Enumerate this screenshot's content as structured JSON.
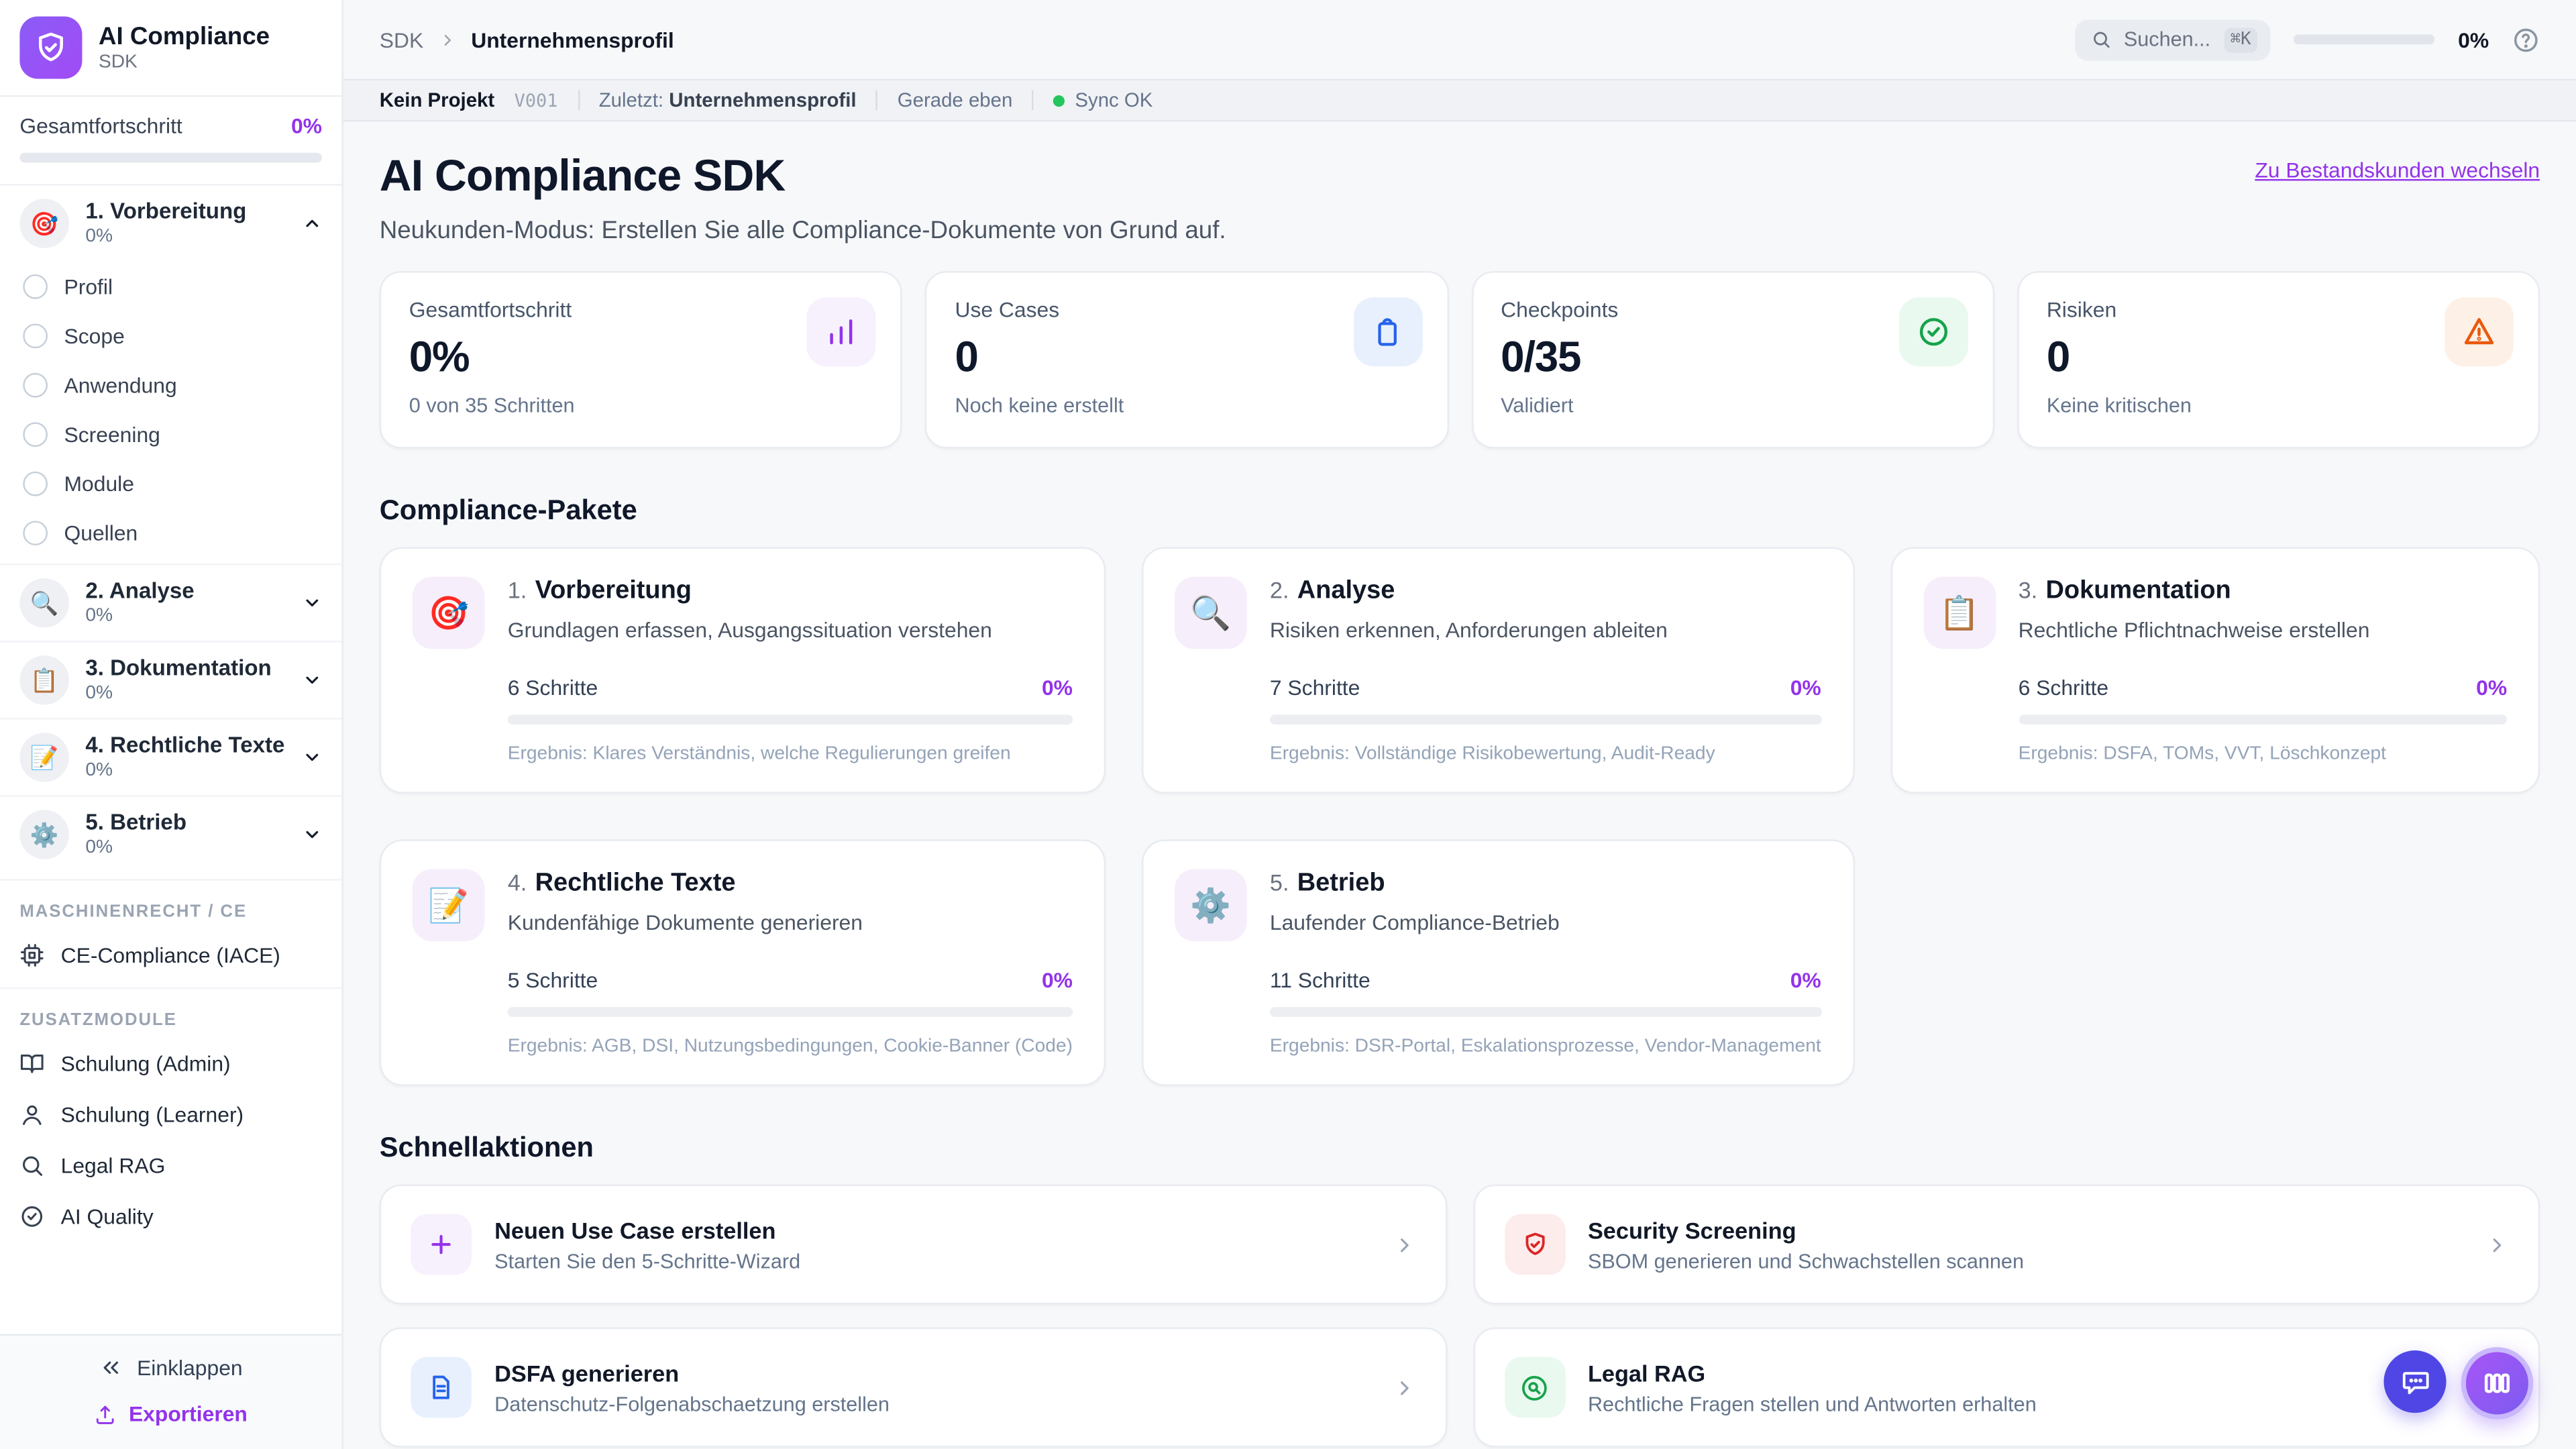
{
  "accent_color": "#9333ea",
  "sync_color": "#22c55e",
  "sidebar": {
    "logo_title": "AI Compliance",
    "logo_subtitle": "SDK",
    "overall_label": "Gesamtfortschritt",
    "overall_percent": "0%",
    "groups": [
      {
        "label": "1. Vorbereitung",
        "percent": "0%",
        "icon": "🎯"
      },
      {
        "label": "2. Analyse",
        "percent": "0%",
        "icon": "🔍"
      },
      {
        "label": "3. Dokumentation",
        "percent": "0%",
        "icon": "📋"
      },
      {
        "label": "4. Rechtliche Texte",
        "percent": "0%",
        "icon": "📝"
      },
      {
        "label": "5. Betrieb",
        "percent": "0%",
        "icon": "⚙️"
      }
    ],
    "sub_items": [
      "Profil",
      "Scope",
      "Anwendung",
      "Screening",
      "Module",
      "Quellen"
    ],
    "section_machine": "MASCHINENRECHT / CE",
    "ce_item": "CE-Compliance (IACE)",
    "section_addons": "ZUSATZMODULE",
    "addons": [
      "Schulung (Admin)",
      "Schulung (Learner)",
      "Legal RAG",
      "AI Quality"
    ],
    "collapse_label": "Einklappen",
    "export_label": "Exportieren"
  },
  "header": {
    "breadcrumb_root": "SDK",
    "breadcrumb_current": "Unternehmensprofil",
    "search_placeholder": "Suchen...",
    "search_shortcut": "⌘K",
    "progress_percent": "0%"
  },
  "statusbar": {
    "project": "Kein Projekt",
    "version": "V001",
    "last_label": "Zuletzt:",
    "last_value": "Unternehmensprofil",
    "time_ago": "Gerade eben",
    "sync_status": "Sync OK"
  },
  "hero": {
    "title": "AI Compliance SDK",
    "subtitle": "Neukunden-Modus: Erstellen Sie alle Compliance-Dokumente von Grund auf.",
    "switch_link": "Zu Bestandskunden wechseln"
  },
  "stats": [
    {
      "label": "Gesamtfortschritt",
      "value": "0%",
      "sub": "0 von 35 Schritten",
      "icon": "bar-chart-icon"
    },
    {
      "label": "Use Cases",
      "value": "0",
      "sub": "Noch keine erstellt",
      "icon": "clipboard-icon"
    },
    {
      "label": "Checkpoints",
      "value": "0/35",
      "sub": "Validiert",
      "icon": "check-circle-icon"
    },
    {
      "label": "Risiken",
      "value": "0",
      "sub": "Keine kritischen",
      "icon": "alert-triangle-icon"
    }
  ],
  "packages": {
    "heading": "Compliance-Pakete",
    "cards": [
      {
        "num": "1.",
        "title": "Vorbereitung",
        "icon": "🎯",
        "desc": "Grundlagen erfassen, Ausgangssituation verstehen",
        "steps": "6 Schritte",
        "percent": "0%",
        "result": "Ergebnis: Klares Verständnis, welche Regulierungen greifen"
      },
      {
        "num": "2.",
        "title": "Analyse",
        "icon": "🔍",
        "desc": "Risiken erkennen, Anforderungen ableiten",
        "steps": "7 Schritte",
        "percent": "0%",
        "result": "Ergebnis: Vollständige Risikobewertung, Audit-Ready"
      },
      {
        "num": "3.",
        "title": "Dokumentation",
        "icon": "📋",
        "desc": "Rechtliche Pflichtnachweise erstellen",
        "steps": "6 Schritte",
        "percent": "0%",
        "result": "Ergebnis: DSFA, TOMs, VVT, Löschkonzept"
      },
      {
        "num": "4.",
        "title": "Rechtliche Texte",
        "icon": "📝",
        "desc": "Kundenfähige Dokumente generieren",
        "steps": "5 Schritte",
        "percent": "0%",
        "result": "Ergebnis: AGB, DSI, Nutzungsbedingungen, Cookie-Banner (Code)"
      },
      {
        "num": "5.",
        "title": "Betrieb",
        "icon": "⚙️",
        "desc": "Laufender Compliance-Betrieb",
        "steps": "11 Schritte",
        "percent": "0%",
        "result": "Ergebnis: DSR-Portal, Eskalationsprozesse, Vendor-Management"
      }
    ]
  },
  "quick": {
    "heading": "Schnellaktionen",
    "actions": [
      {
        "title": "Neuen Use Case erstellen",
        "sub": "Starten Sie den 5-Schritte-Wizard",
        "icon": "plus-icon"
      },
      {
        "title": "Security Screening",
        "sub": "SBOM generieren und Schwachstellen scannen",
        "icon": "shield-check-icon"
      },
      {
        "title": "DSFA generieren",
        "sub": "Datenschutz-Folgenabschaetzung erstellen",
        "icon": "document-icon"
      },
      {
        "title": "Legal RAG",
        "sub": "Rechtliche Fragen stellen und Antworten erhalten",
        "icon": "search-circle-icon"
      }
    ]
  }
}
